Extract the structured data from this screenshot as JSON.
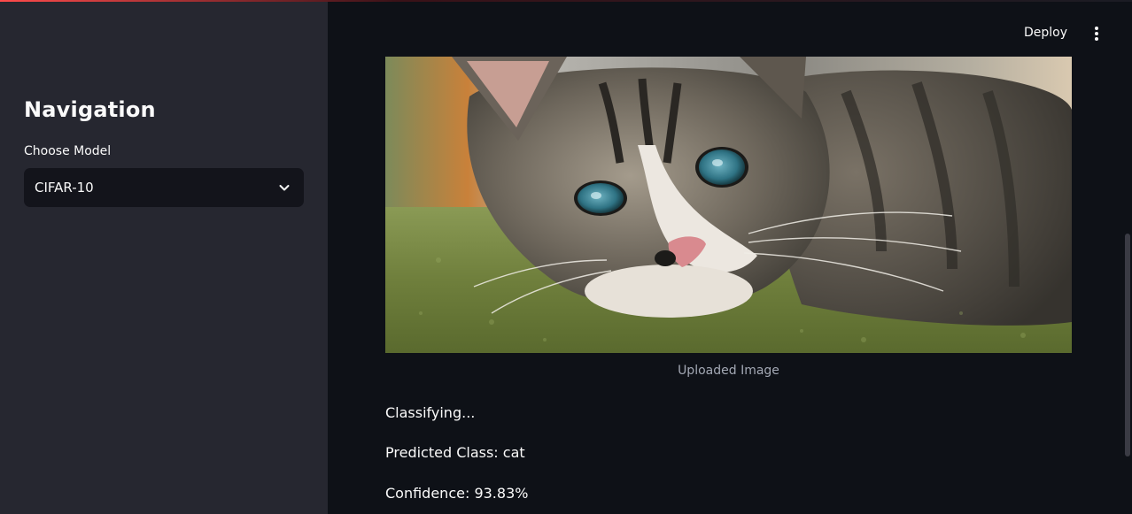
{
  "sidebar": {
    "title": "Navigation",
    "model_label": "Choose Model",
    "model_value": "CIFAR-10"
  },
  "header": {
    "deploy_label": "Deploy"
  },
  "main": {
    "image_caption": "Uploaded Image",
    "status_text": "Classifying...",
    "predicted_text": "Predicted Class: cat",
    "confidence_text": "Confidence: 93.83%"
  },
  "icons": {
    "select_chevron": "chevron-down-icon",
    "menu": "more-vertical-icon"
  },
  "colors": {
    "sidebar_bg": "#262730",
    "main_bg": "#0e1117",
    "accent": "#ff4b4b"
  }
}
